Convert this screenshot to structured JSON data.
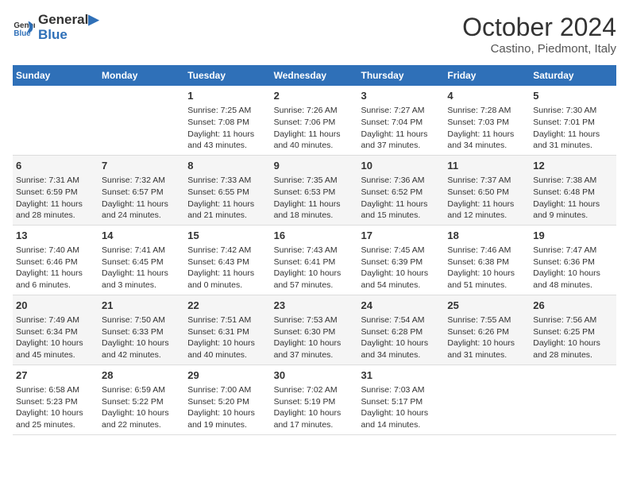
{
  "header": {
    "logo_general": "General",
    "logo_blue": "Blue",
    "title": "October 2024",
    "subtitle": "Castino, Piedmont, Italy"
  },
  "weekdays": [
    "Sunday",
    "Monday",
    "Tuesday",
    "Wednesday",
    "Thursday",
    "Friday",
    "Saturday"
  ],
  "rows": [
    [
      {
        "day": "",
        "info": ""
      },
      {
        "day": "",
        "info": ""
      },
      {
        "day": "1",
        "info": "Sunrise: 7:25 AM\nSunset: 7:08 PM\nDaylight: 11 hours and 43 minutes."
      },
      {
        "day": "2",
        "info": "Sunrise: 7:26 AM\nSunset: 7:06 PM\nDaylight: 11 hours and 40 minutes."
      },
      {
        "day": "3",
        "info": "Sunrise: 7:27 AM\nSunset: 7:04 PM\nDaylight: 11 hours and 37 minutes."
      },
      {
        "day": "4",
        "info": "Sunrise: 7:28 AM\nSunset: 7:03 PM\nDaylight: 11 hours and 34 minutes."
      },
      {
        "day": "5",
        "info": "Sunrise: 7:30 AM\nSunset: 7:01 PM\nDaylight: 11 hours and 31 minutes."
      }
    ],
    [
      {
        "day": "6",
        "info": "Sunrise: 7:31 AM\nSunset: 6:59 PM\nDaylight: 11 hours and 28 minutes."
      },
      {
        "day": "7",
        "info": "Sunrise: 7:32 AM\nSunset: 6:57 PM\nDaylight: 11 hours and 24 minutes."
      },
      {
        "day": "8",
        "info": "Sunrise: 7:33 AM\nSunset: 6:55 PM\nDaylight: 11 hours and 21 minutes."
      },
      {
        "day": "9",
        "info": "Sunrise: 7:35 AM\nSunset: 6:53 PM\nDaylight: 11 hours and 18 minutes."
      },
      {
        "day": "10",
        "info": "Sunrise: 7:36 AM\nSunset: 6:52 PM\nDaylight: 11 hours and 15 minutes."
      },
      {
        "day": "11",
        "info": "Sunrise: 7:37 AM\nSunset: 6:50 PM\nDaylight: 11 hours and 12 minutes."
      },
      {
        "day": "12",
        "info": "Sunrise: 7:38 AM\nSunset: 6:48 PM\nDaylight: 11 hours and 9 minutes."
      }
    ],
    [
      {
        "day": "13",
        "info": "Sunrise: 7:40 AM\nSunset: 6:46 PM\nDaylight: 11 hours and 6 minutes."
      },
      {
        "day": "14",
        "info": "Sunrise: 7:41 AM\nSunset: 6:45 PM\nDaylight: 11 hours and 3 minutes."
      },
      {
        "day": "15",
        "info": "Sunrise: 7:42 AM\nSunset: 6:43 PM\nDaylight: 11 hours and 0 minutes."
      },
      {
        "day": "16",
        "info": "Sunrise: 7:43 AM\nSunset: 6:41 PM\nDaylight: 10 hours and 57 minutes."
      },
      {
        "day": "17",
        "info": "Sunrise: 7:45 AM\nSunset: 6:39 PM\nDaylight: 10 hours and 54 minutes."
      },
      {
        "day": "18",
        "info": "Sunrise: 7:46 AM\nSunset: 6:38 PM\nDaylight: 10 hours and 51 minutes."
      },
      {
        "day": "19",
        "info": "Sunrise: 7:47 AM\nSunset: 6:36 PM\nDaylight: 10 hours and 48 minutes."
      }
    ],
    [
      {
        "day": "20",
        "info": "Sunrise: 7:49 AM\nSunset: 6:34 PM\nDaylight: 10 hours and 45 minutes."
      },
      {
        "day": "21",
        "info": "Sunrise: 7:50 AM\nSunset: 6:33 PM\nDaylight: 10 hours and 42 minutes."
      },
      {
        "day": "22",
        "info": "Sunrise: 7:51 AM\nSunset: 6:31 PM\nDaylight: 10 hours and 40 minutes."
      },
      {
        "day": "23",
        "info": "Sunrise: 7:53 AM\nSunset: 6:30 PM\nDaylight: 10 hours and 37 minutes."
      },
      {
        "day": "24",
        "info": "Sunrise: 7:54 AM\nSunset: 6:28 PM\nDaylight: 10 hours and 34 minutes."
      },
      {
        "day": "25",
        "info": "Sunrise: 7:55 AM\nSunset: 6:26 PM\nDaylight: 10 hours and 31 minutes."
      },
      {
        "day": "26",
        "info": "Sunrise: 7:56 AM\nSunset: 6:25 PM\nDaylight: 10 hours and 28 minutes."
      }
    ],
    [
      {
        "day": "27",
        "info": "Sunrise: 6:58 AM\nSunset: 5:23 PM\nDaylight: 10 hours and 25 minutes."
      },
      {
        "day": "28",
        "info": "Sunrise: 6:59 AM\nSunset: 5:22 PM\nDaylight: 10 hours and 22 minutes."
      },
      {
        "day": "29",
        "info": "Sunrise: 7:00 AM\nSunset: 5:20 PM\nDaylight: 10 hours and 19 minutes."
      },
      {
        "day": "30",
        "info": "Sunrise: 7:02 AM\nSunset: 5:19 PM\nDaylight: 10 hours and 17 minutes."
      },
      {
        "day": "31",
        "info": "Sunrise: 7:03 AM\nSunset: 5:17 PM\nDaylight: 10 hours and 14 minutes."
      },
      {
        "day": "",
        "info": ""
      },
      {
        "day": "",
        "info": ""
      }
    ]
  ]
}
